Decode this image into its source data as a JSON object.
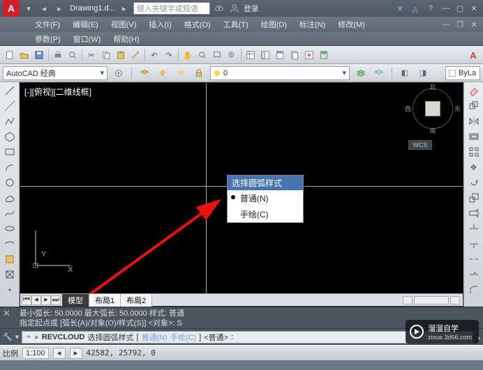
{
  "title": {
    "doc": "Drawing1.d...",
    "search_placeholder": "键入关键字或短语",
    "login": "登录"
  },
  "menu": {
    "row1": [
      "文件(F)",
      "编辑(E)",
      "视图(V)",
      "插入(I)",
      "格式(O)",
      "工具(T)",
      "绘图(D)",
      "标注(N)",
      "修改(M)"
    ],
    "row2": [
      "参数(P)",
      "窗口(W)",
      "帮助(H)"
    ]
  },
  "workspace": {
    "name": "AutoCAD 经典",
    "bylayer": "ByLa"
  },
  "viewport": {
    "label": "[-][俯视][二维线框]",
    "wcs": "WCS",
    "dir_n": "北",
    "dir_s": "南",
    "dir_e": "东",
    "dir_w": "西"
  },
  "context_menu": {
    "title": "选择圆弧样式",
    "opt_normal": "普通(N)",
    "opt_hand": "手绘(C)"
  },
  "tabs": {
    "model": "模型",
    "layout1": "布局1",
    "layout2": "布局2"
  },
  "command": {
    "hist1": "最小弧长: 50.0000    最大弧长: 50.0000    样式: 普通",
    "hist2": "指定起点或 [弧长(A)/对象(O)/样式(S)] <对象>: S",
    "kw_rev": "REVCLOUD",
    "prompt": "选择圆弧样式",
    "opt_n": "普通(N)",
    "opt_c": "手绘(C)",
    "default": "<普通>"
  },
  "status": {
    "scale_label": "比例",
    "scale_value": "1:100",
    "coords": "42582, 25792, 0"
  },
  "axes": {
    "x": "X",
    "y": "Y"
  },
  "watermark": {
    "brand": "溜溜自学",
    "url": "zixue.3d66.com"
  }
}
